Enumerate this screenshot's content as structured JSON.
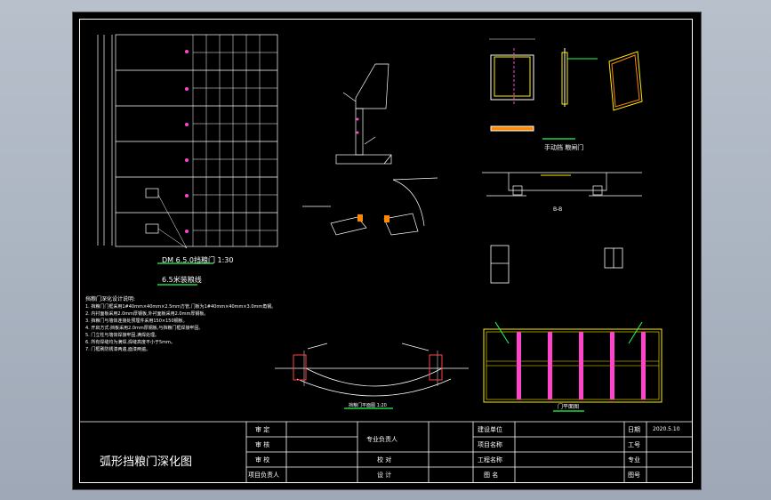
{
  "drawing": {
    "title": "弧形挡粮门深化图",
    "door_caption": "DM 6.5.0挡粮门 1:30",
    "door_subcaption": "6.5米装粮线",
    "hand_door": "手动挡 粮闸门",
    "section_label": "B-B",
    "arc_caption": "挡粮门平面图 1:20",
    "bottom_right_caption": "门平面图"
  },
  "notes": [
    "挡粮门深化设计说明:",
    "1. 挡粮门门框采用1#40mm×40mm×2.5mm方管,门板为1#40mm×40mm×3.0mm角钢。",
    "2. 内衬面板采用2.0mm厚钢板,外衬面板采用2.0mm厚钢板。",
    "3. 挡粮门与墙体连接处预埋件采用150×150钢板。",
    "4. 开启方式:挡板采用2.0mm厚钢板,与挡粮门框焊接牢固。",
    "5. 门立柱与墙体焊接牢固,满焊处理。",
    "6. 所有焊缝均为满焊,焊缝高度不小于5mm。",
    "7. 门框刷防锈漆两遍,面漆两遍。"
  ],
  "title_block": {
    "shen_ding": "审 定",
    "shen_he": "审 核",
    "shen_jiao": "审 校",
    "xiangmu_fuzeren": "项目负责人",
    "zhuanye_fuzeren": "专业负责人",
    "jiaodui": "校 对",
    "sheji": "设 计",
    "jianshe_danwei": "建设单位",
    "xiangmu_mingcheng": "项目名称",
    "gongcheng_mingcheng": "工程名称",
    "tu_ming": "图 名",
    "riqi_label": "日期",
    "riqi_value": "2020.5.10",
    "gonghao_label": "工号",
    "zhuanye_label": "专业",
    "tuhao_label": "图号"
  },
  "colors": {
    "sheet": "#000000",
    "line": "#ffffff",
    "accent_yellow": "#ffee00",
    "accent_magenta": "#ff44cc",
    "accent_green": "#22ff55",
    "accent_red": "#ff4444"
  }
}
